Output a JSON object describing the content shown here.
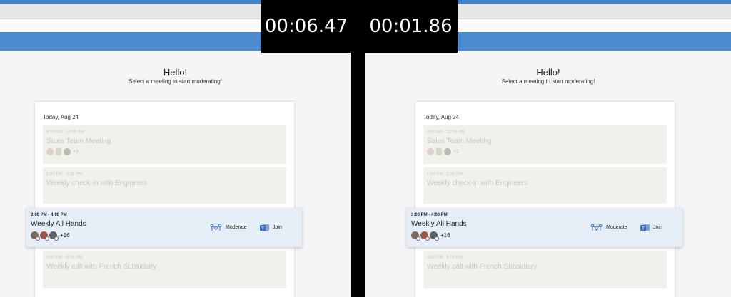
{
  "timers": [
    "00:06.47",
    "00:01.86"
  ],
  "greeting": "Hello!",
  "subtitle": "Select a meeting to start moderating!",
  "date": "Today, Aug 24",
  "meetings": [
    {
      "time": "9:00 AM - 10:00 AM",
      "title": "Sales Team Meeting",
      "more": "+2"
    },
    {
      "time": "1:00 PM - 2:30 PM",
      "title": "Weekly check-in with Engineers"
    },
    {
      "time": "3:00 PM - 4:00 PM",
      "title": "Weekly All Hands",
      "more": "+16",
      "moderate_label": "Moderate",
      "join_label": "Join"
    },
    {
      "time": "4:00 PM - 5:00 PM",
      "title": "Weekly call with French Subsidiary"
    }
  ],
  "colors": {
    "accent": "#4a8bd0",
    "active_bg": "#e5edf7",
    "icon_blue": "#3b78c4"
  },
  "icons": {
    "moderate": "moderate-icon",
    "join": "teams-icon"
  }
}
